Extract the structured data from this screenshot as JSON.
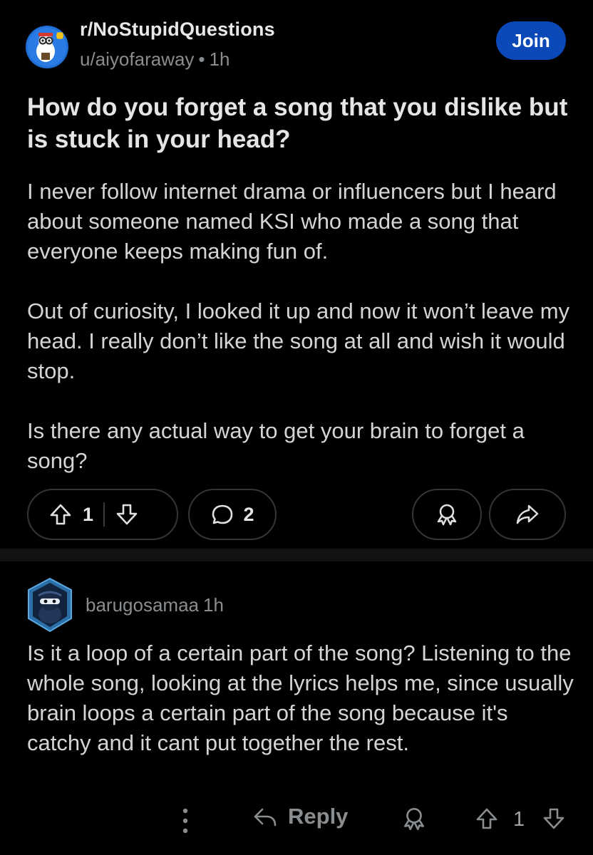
{
  "post": {
    "subreddit": "r/NoStupidQuestions",
    "author": "u/aiyofaraway",
    "separator": "•",
    "age": "1h",
    "join_label": "Join",
    "title": "How do you forget a song that you dislike but is stuck in your head?",
    "paragraphs": [
      "I never follow internet drama or influencers but I heard about someone named KSI who made a song that everyone keeps making fun of.",
      "Out of curiosity, I looked it up and now it won’t leave my head. I really don’t like the song at all and wish it would stop.",
      "Is there any actual way to get your brain to forget a song?"
    ],
    "vote_count": "1",
    "comment_count": "2"
  },
  "comment": {
    "username": "barugosamaa",
    "age": "1h",
    "body": "Is it a loop of a certain part of the song? Listening to the whole song, looking at the lyrics helps me, since usually brain loops a certain part of the song because it's catchy and it cant put together the rest.",
    "reply_label": "Reply",
    "vote_count": "1"
  },
  "icons": {
    "subreddit_avatar": "subreddit-avatar-icon",
    "upvote": "upvote-arrow-icon",
    "downvote": "downvote-arrow-icon",
    "comment": "comment-bubble-icon",
    "award": "award-icon",
    "share": "share-arrow-icon",
    "more": "more-vertical-icon",
    "reply": "reply-arrow-icon"
  },
  "colors": {
    "background": "#000000",
    "join_button": "#0b48b8",
    "border": "#343536",
    "meta_text": "#8a8d90"
  }
}
